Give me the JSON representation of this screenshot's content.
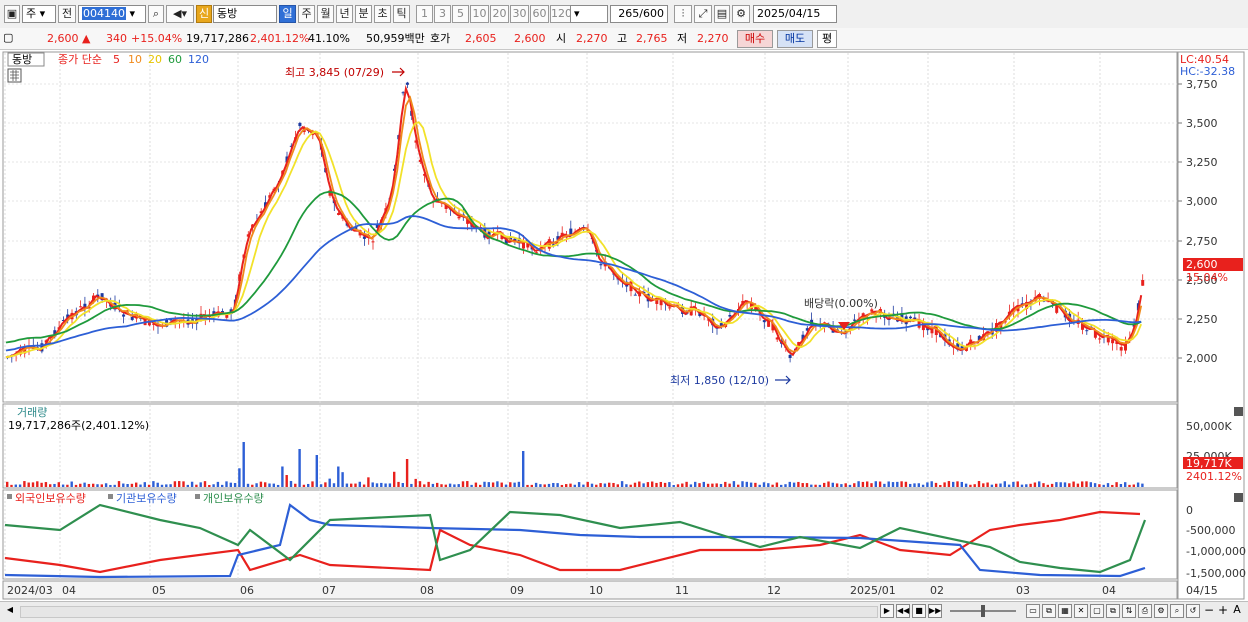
{
  "toolbar": {
    "market": "주",
    "prev": "전",
    "code": "004140",
    "badge": "신",
    "name": "동방",
    "periods": [
      "일",
      "주",
      "월",
      "년",
      "분",
      "초",
      "틱"
    ],
    "active_period": "일",
    "intervals": [
      "1",
      "3",
      "5",
      "10",
      "20",
      "30",
      "60",
      "120"
    ],
    "count": "265",
    "total": "/600",
    "date": "2025/04/15"
  },
  "quote": {
    "price": "2,600",
    "change": "340",
    "change_pct": "+15.04%",
    "volume": "19,717,286",
    "volume_pct": "2,401.12%",
    "turnover": "41.10%",
    "amount": "50,959백만",
    "hoga_label": "호가",
    "hoga1": "2,605",
    "hoga2": "2,600",
    "open_label": "시",
    "open": "2,270",
    "high_label": "고",
    "high": "2,765",
    "low_label": "저",
    "low": "2,270",
    "buy": "매수",
    "sell": "매도",
    "avg": "평"
  },
  "chart": {
    "legend_name": "동방",
    "legend_ma_label": "종가 단순",
    "ma_periods": [
      "5",
      "10",
      "20",
      "60",
      "120"
    ],
    "ma_colors": [
      "#e8211d",
      "#f08a1c",
      "#f2e22a",
      "#1f9a3c",
      "#2d5fd6"
    ],
    "lc": "LC:40.54",
    "hc": "HC:-32.38",
    "high_note": "최고 3,845 (07/29)",
    "low_note": "최저 1,850 (12/10)",
    "dividend_note": "배당락(0.00%)",
    "price_ticks": [
      "3,750",
      "3,500",
      "3,250",
      "3,000",
      "2,750",
      "2,500",
      "2,250",
      "2,000"
    ],
    "last_price_tag": "2,600",
    "last_pct_tag": "15.04%"
  },
  "volume_panel": {
    "title": "거래량",
    "value": "19,717,286주(2,401.12%)",
    "ticks": [
      "50,000K",
      "25,000K"
    ],
    "tag": "19,717K",
    "tag_pct": "2401.12%"
  },
  "holding_panel": {
    "legend": [
      "외국인보유수량",
      "기관보유수량",
      "개인보유수량"
    ],
    "colors": [
      "#e8211d",
      "#2d5fd6",
      "#2f8f4f"
    ],
    "ticks": [
      "0",
      "-500,000",
      "-1,000,000",
      "-1,500,000"
    ]
  },
  "x_axis": [
    "2024/03",
    "04",
    "05",
    "06",
    "07",
    "08",
    "09",
    "10",
    "11",
    "12",
    "2025/01",
    "02",
    "03",
    "04"
  ],
  "x_end": "04/15"
}
